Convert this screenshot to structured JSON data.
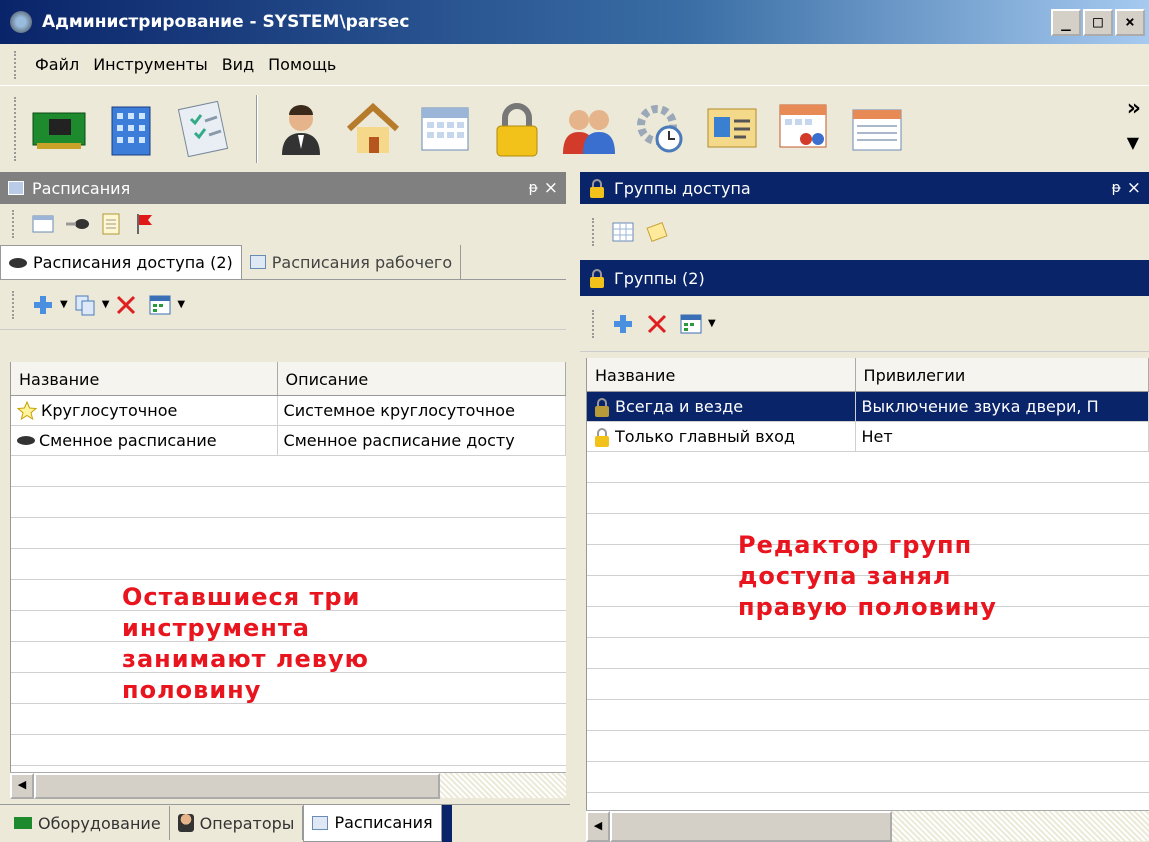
{
  "window": {
    "title": "Администрирование - SYSTEM\\parsec",
    "min_label": "_",
    "max_label": "□",
    "close_label": "×"
  },
  "menu": [
    "Файл",
    "Инструменты",
    "Вид",
    "Помощь"
  ],
  "toolbar": {
    "icons": [
      "equipment-board-icon",
      "building-icon",
      "checklist-icon",
      "operator-icon",
      "house-icon",
      "calendar-icon",
      "lock-icon",
      "users-icon",
      "gear-clock-icon",
      "id-card-icon",
      "calendar-users-icon",
      "calendar-list-icon"
    ],
    "more_label": "»",
    "dropdown_label": "▼"
  },
  "left": {
    "title": "Расписания",
    "pin": "ᵽ",
    "close": "×",
    "tabs": [
      "Расписания доступа (2)",
      "Расписания рабочего"
    ],
    "columns": [
      "Название",
      "Описание"
    ],
    "rows": [
      [
        "Круглосуточное",
        "Системное круглосуточное"
      ],
      [
        "Сменное расписание",
        "Сменное расписание досту"
      ]
    ],
    "note": [
      "Оставшиеся три",
      "инструмента",
      "занимают левую",
      "половину"
    ],
    "bottom_tabs": [
      "Оборудование",
      "Операторы",
      "Расписания"
    ]
  },
  "right": {
    "title": "Группы доступа",
    "pin": "ᵽ",
    "close": "×",
    "subtitle": "Группы (2)",
    "columns": [
      "Название",
      "Привилегии"
    ],
    "rows": [
      [
        "Всегда и везде",
        "Выключение звука двери, П"
      ],
      [
        "Только главный вход",
        "Нет"
      ]
    ],
    "note": [
      "Редактор групп",
      "доступа занял",
      "правую половину"
    ]
  },
  "colors": {
    "active_title": "#0A246A",
    "inactive_title": "#808080",
    "note": "#E8141E"
  }
}
